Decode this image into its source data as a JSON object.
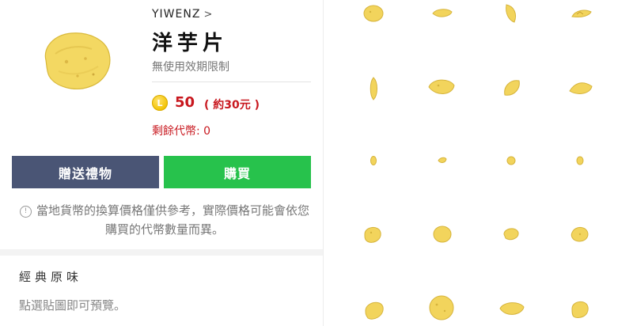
{
  "product": {
    "creator": "YIWENZ",
    "creator_chevron": ">",
    "title": "洋芋片",
    "validity": "無使用效期限制",
    "coin_symbol": "L",
    "price": "50",
    "price_approx": "( 約30元 )",
    "remaining": "剩餘代幣: 0"
  },
  "actions": {
    "gift_label": "贈送禮物",
    "buy_label": "購買"
  },
  "notice": {
    "icon_glyph": "!",
    "text": "當地貨幣的換算價格僅供參考，實際價格可能會依您購買的代幣數量而異。"
  },
  "section": {
    "title": "經典原味",
    "hint": "點選貼圖即可預覽。"
  },
  "colors": {
    "price_red": "#c8171e",
    "gift_button": "#4a5575",
    "buy_button": "#27c24c",
    "chip_yellow": "#f2d45c"
  }
}
